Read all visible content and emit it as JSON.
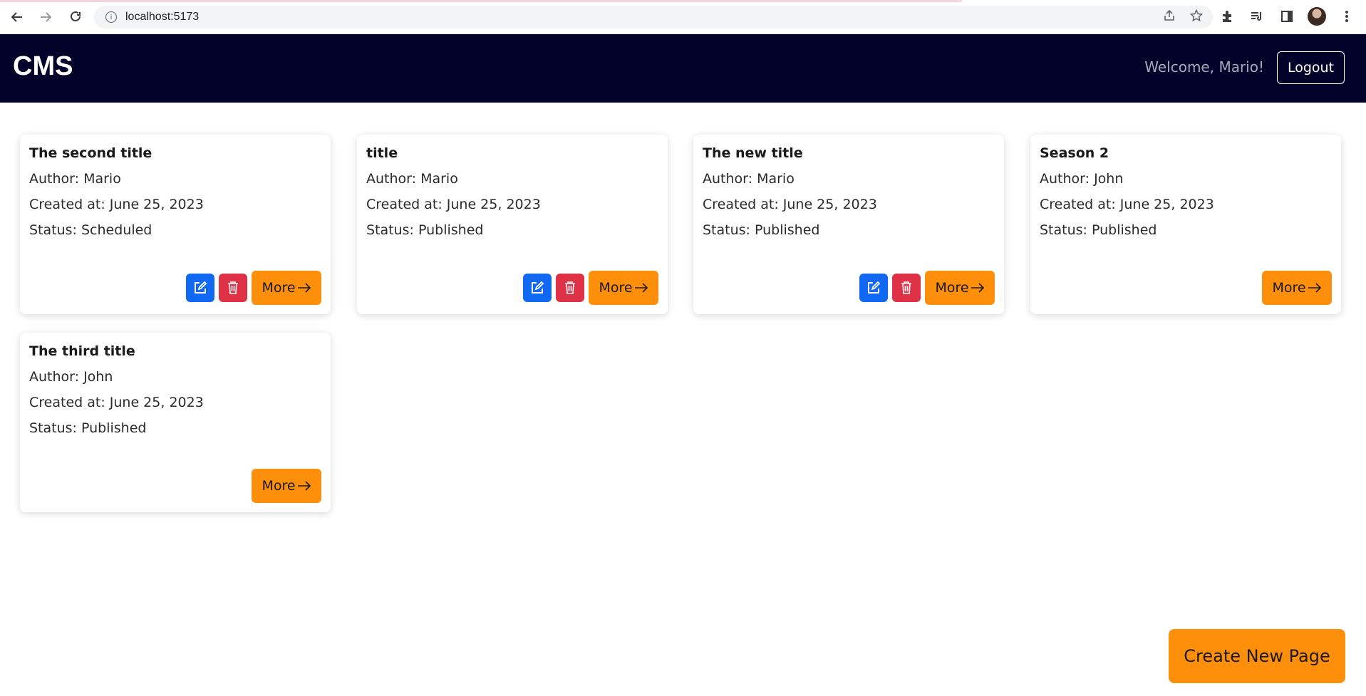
{
  "browser": {
    "url": "localhost:5173",
    "icons": [
      "back-icon",
      "forward-icon",
      "reload-icon",
      "info-icon",
      "share-icon",
      "star-icon",
      "extensions-icon",
      "media-icon",
      "side-panel-icon",
      "profile-avatar",
      "menu-icon"
    ]
  },
  "header": {
    "brand": "CMS",
    "welcome": "Welcome, Mario!",
    "logout_label": "Logout",
    "background": "#02012a"
  },
  "cards": [
    {
      "title": "The second title",
      "author": "Author: Mario",
      "created": "Created at: June 25, 2023",
      "status": "Status: Scheduled",
      "editable": true,
      "more_label": "More"
    },
    {
      "title": "title",
      "author": "Author: Mario",
      "created": "Created at: June 25, 2023",
      "status": "Status: Published",
      "editable": true,
      "more_label": "More"
    },
    {
      "title": "The new title",
      "author": "Author: Mario",
      "created": "Created at: June 25, 2023",
      "status": "Status: Published",
      "editable": true,
      "more_label": "More"
    },
    {
      "title": "Season 2",
      "author": "Author: John",
      "created": "Created at: June 25, 2023",
      "status": "Status: Published",
      "editable": false,
      "more_label": "More"
    },
    {
      "title": "The third title",
      "author": "Author: John",
      "created": "Created at: June 25, 2023",
      "status": "Status: Published",
      "editable": false,
      "more_label": "More"
    }
  ],
  "create_label": "Create New Page",
  "colors": {
    "accent": "#fd8f0b",
    "edit": "#1168f2",
    "delete": "#e03246"
  }
}
